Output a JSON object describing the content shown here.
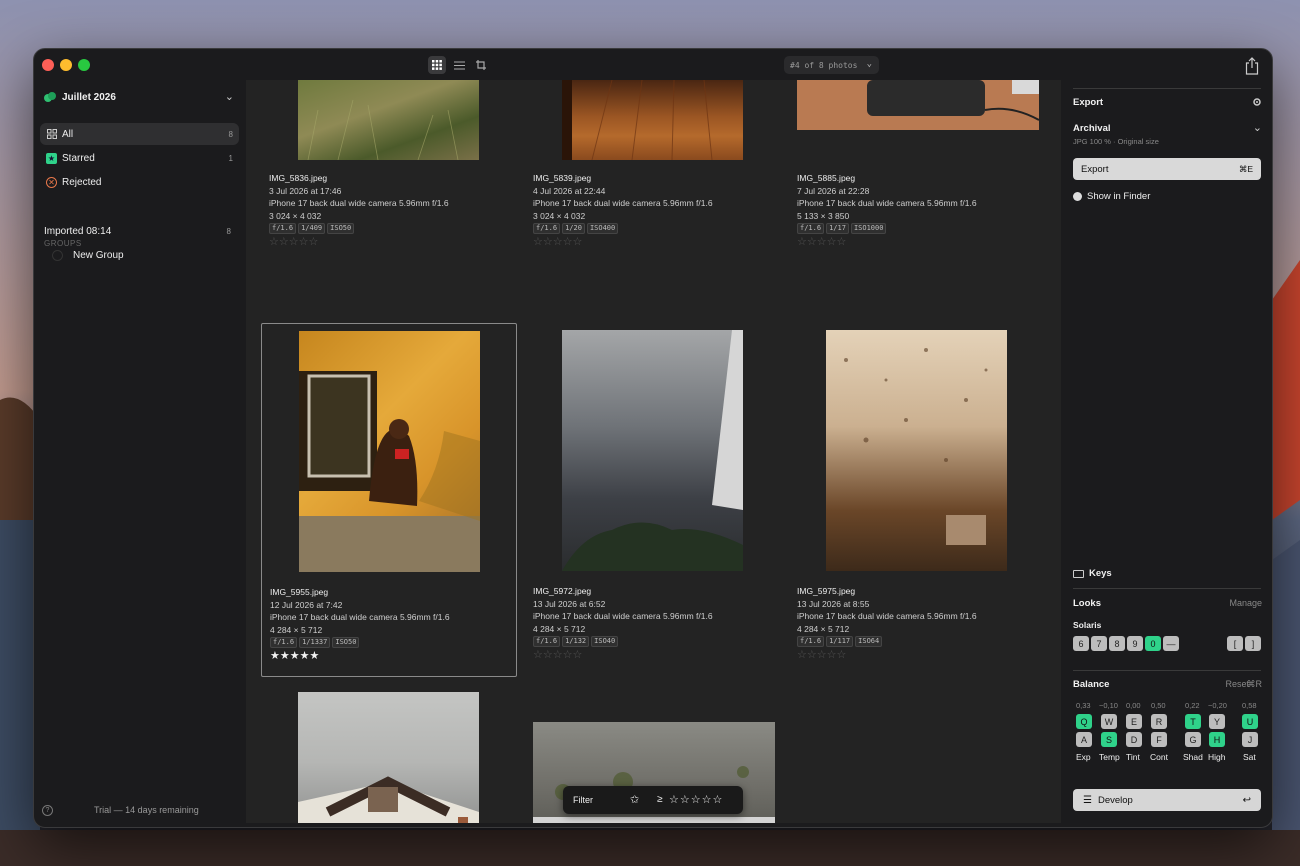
{
  "window": {
    "view_toggles": [
      "grid-icon",
      "list-icon",
      "crop-icon"
    ],
    "photo_picker": "#4 of 8 photos"
  },
  "sidebar": {
    "library": "Juillet 2026",
    "items": [
      {
        "label": "All",
        "count": "8",
        "icon": "grid-icon"
      },
      {
        "label": "Starred",
        "count": "1",
        "icon": "star-icon"
      },
      {
        "label": "Rejected",
        "count": "",
        "icon": "reject-icon"
      }
    ],
    "groups_header": "GROUPS",
    "groups": [
      {
        "label": "Imported 08:14",
        "count": "8"
      },
      {
        "label": "New Group",
        "count": ""
      }
    ],
    "footer": "Trial — 14 days remaining"
  },
  "photos": [
    {
      "name": "IMG_5836.jpeg",
      "date": "3 Jul 2026 at 17:46",
      "camera": "iPhone 17 back dual wide camera 5.96mm f/1.6",
      "dims": "3 024 × 4 032",
      "tags": [
        "f/1.6",
        "1/409",
        "ISO50"
      ],
      "rating": 0
    },
    {
      "name": "IMG_5839.jpeg",
      "date": "4 Jul 2026 at 22:44",
      "camera": "iPhone 17 back dual wide camera 5.96mm f/1.6",
      "dims": "3 024 × 4 032",
      "tags": [
        "f/1.6",
        "1/20",
        "ISO400"
      ],
      "rating": 0
    },
    {
      "name": "IMG_5885.jpeg",
      "date": "7 Jul 2026 at 22:28",
      "camera": "iPhone 17 back dual wide camera 5.96mm f/1.6",
      "dims": "5 133 × 3 850",
      "tags": [
        "f/1.6",
        "1/17",
        "ISO1000"
      ],
      "rating": 0
    },
    {
      "name": "IMG_5955.jpeg",
      "date": "12 Jul 2026 at 7:42",
      "camera": "iPhone 17 back dual wide camera 5.96mm f/1.6",
      "dims": "4 284 × 5 712",
      "tags": [
        "f/1.6",
        "1/1337",
        "ISO50"
      ],
      "rating": 5
    },
    {
      "name": "IMG_5972.jpeg",
      "date": "13 Jul 2026 at 6:52",
      "camera": "iPhone 17 back dual wide camera 5.96mm f/1.6",
      "dims": "4 284 × 5 712",
      "tags": [
        "f/1.6",
        "1/132",
        "ISO40"
      ],
      "rating": 0
    },
    {
      "name": "IMG_5975.jpeg",
      "date": "13 Jul 2026 at 8:55",
      "camera": "iPhone 17 back dual wide camera 5.96mm f/1.6",
      "dims": "4 284 × 5 712",
      "tags": [
        "f/1.6",
        "1/117",
        "ISO64"
      ],
      "rating": 0
    }
  ],
  "filter": {
    "label": "Filter",
    "comparator": "≥"
  },
  "export": {
    "header": "Export",
    "preset": "Archival",
    "preset_detail": "JPG 100 % · Original size",
    "button": "Export",
    "button_shortcut": "⌘E",
    "show_in_finder": "Show in Finder"
  },
  "keys": {
    "label": "Keys"
  },
  "looks": {
    "header": "Looks",
    "manage": "Manage",
    "name": "Solaris",
    "buttons": [
      "6",
      "7",
      "8",
      "9",
      "0",
      "—"
    ],
    "active": "0",
    "nav": [
      "[",
      "]"
    ]
  },
  "balance": {
    "header": "Balance",
    "reset": "Reset",
    "reset_shortcut": "⌘R",
    "columns": [
      {
        "value": "0,33",
        "up": "Q",
        "down": "A",
        "label": "Exp",
        "up_on": true,
        "down_on": false
      },
      {
        "value": "−0,10",
        "up": "W",
        "down": "S",
        "label": "Temp",
        "up_on": false,
        "down_on": true
      },
      {
        "value": "0,00",
        "up": "E",
        "down": "D",
        "label": "Tint",
        "up_on": false,
        "down_on": false
      },
      {
        "value": "0,50",
        "up": "R",
        "down": "F",
        "label": "Cont",
        "up_on": false,
        "down_on": false
      },
      {
        "value": "0,22",
        "up": "T",
        "down": "G",
        "label": "Shad",
        "up_on": true,
        "down_on": false
      },
      {
        "value": "−0,20",
        "up": "Y",
        "down": "H",
        "label": "High",
        "up_on": false,
        "down_on": true
      },
      {
        "value": "0,58",
        "up": "U",
        "down": "J",
        "label": "Sat",
        "up_on": true,
        "down_on": false
      }
    ],
    "accent": "#2fd28a"
  },
  "develop": {
    "label": "Develop",
    "shortcut": "↩"
  }
}
